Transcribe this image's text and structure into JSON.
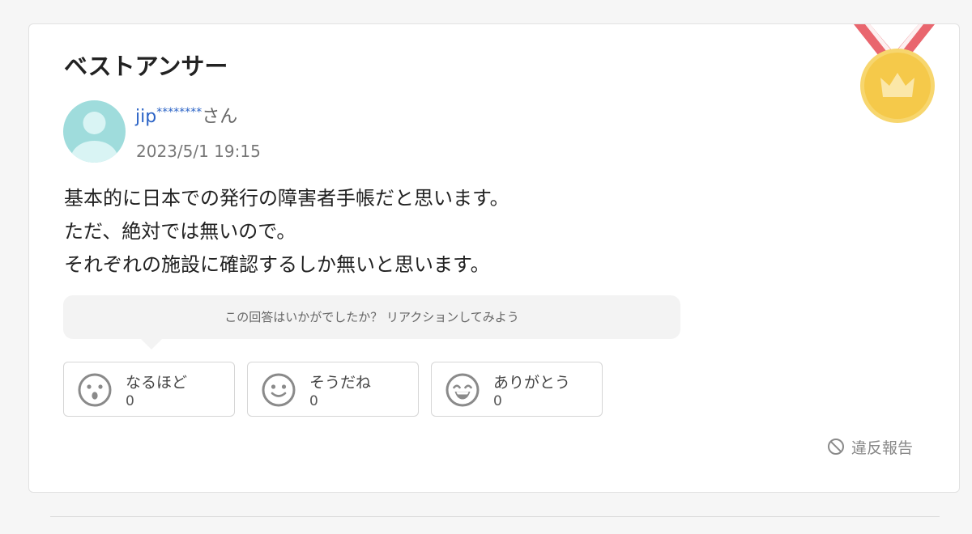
{
  "heading": "ベストアンサー",
  "answerer": {
    "id": "jip",
    "mask": "********",
    "suffix": "さん",
    "date": "2023/5/1 19:15"
  },
  "answer_lines": [
    "基本的に日本での発行の障害者手帳だと思います。",
    "ただ、絶対では無いので。",
    "それぞれの施設に確認するしか無いと思います。"
  ],
  "reaction_prompt": "この回答はいかがでしたか？ リアクションしてみよう",
  "reactions": [
    {
      "label": "なるほど",
      "count": "0",
      "icon": "surprised-face-icon"
    },
    {
      "label": "そうだね",
      "count": "0",
      "icon": "smile-face-icon"
    },
    {
      "label": "ありがとう",
      "count": "0",
      "icon": "grin-face-icon"
    }
  ],
  "report_label": "違反報告",
  "colors": {
    "username": "#2b63c6",
    "medal_gold": "#f5c94a",
    "medal_ribbon": "#e9666e",
    "avatar": "#9fdcdc"
  }
}
